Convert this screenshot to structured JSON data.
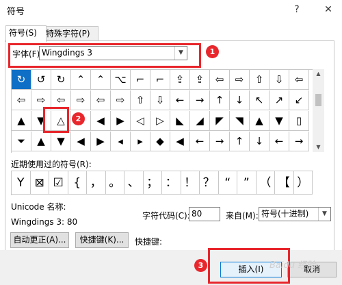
{
  "window": {
    "title": "符号",
    "help_glyph": "?",
    "close_glyph": "✕"
  },
  "tabs": [
    {
      "label": "符号(S)"
    },
    {
      "label": "特殊字符(P)"
    }
  ],
  "font_select": {
    "label": "字体(F):",
    "value": "Wingdings 3"
  },
  "symbol_grid": {
    "rows": [
      [
        "↻",
        "↺",
        "↻",
        "⌃",
        "⌃",
        "⌥",
        "⌐",
        "⌐",
        "⇪",
        "⇪",
        "⇦",
        "⇨",
        "⇧",
        "⇩",
        "⇦"
      ],
      [
        "⇦",
        "⇨",
        "⇦",
        "⇨",
        "⇦",
        "⇨",
        "⇧",
        "⇩",
        "←",
        "→",
        "↑",
        "↓",
        "↖",
        "↗",
        "↙"
      ],
      [
        "▲",
        "▼",
        "△",
        "▽",
        "◀",
        "▶",
        "◁",
        "▷",
        "◣",
        "◢",
        "◤",
        "◥",
        "▲",
        "▼",
        "▯"
      ],
      [
        "⏷",
        "▲",
        "▼",
        "◀",
        "▶",
        "◂",
        "▸",
        "◆",
        "◀",
        "←",
        "→",
        "↑",
        "↓",
        "←",
        "→"
      ]
    ],
    "selected_row": 0,
    "selected_col": 0
  },
  "recent": {
    "label": "近期使用过的符号(R):",
    "symbols": [
      "Y",
      "⊠",
      "☑",
      "{",
      "，",
      "。",
      "、",
      "；",
      "：",
      "！",
      "？",
      "“",
      "”",
      "（",
      "【",
      "）"
    ]
  },
  "info": {
    "unicode_label": "Unicode 名称:",
    "char_name": "Wingdings 3: 80",
    "code_label": "字符代码(C):",
    "code_value": "80",
    "from_label": "来自(M):",
    "from_value": "符号(十进制)"
  },
  "buttons": {
    "autocorrect": "自动更正(A)...",
    "shortcut_key": "快捷键(K)...",
    "shortcut_label": "快捷键:",
    "insert": "插入(I)",
    "cancel": "取消"
  },
  "annotations": [
    "1",
    "2",
    "3"
  ],
  "watermark": "Baidu 经验",
  "colors": {
    "accent": "#0f6fc6",
    "highlight": "#e8262c"
  }
}
